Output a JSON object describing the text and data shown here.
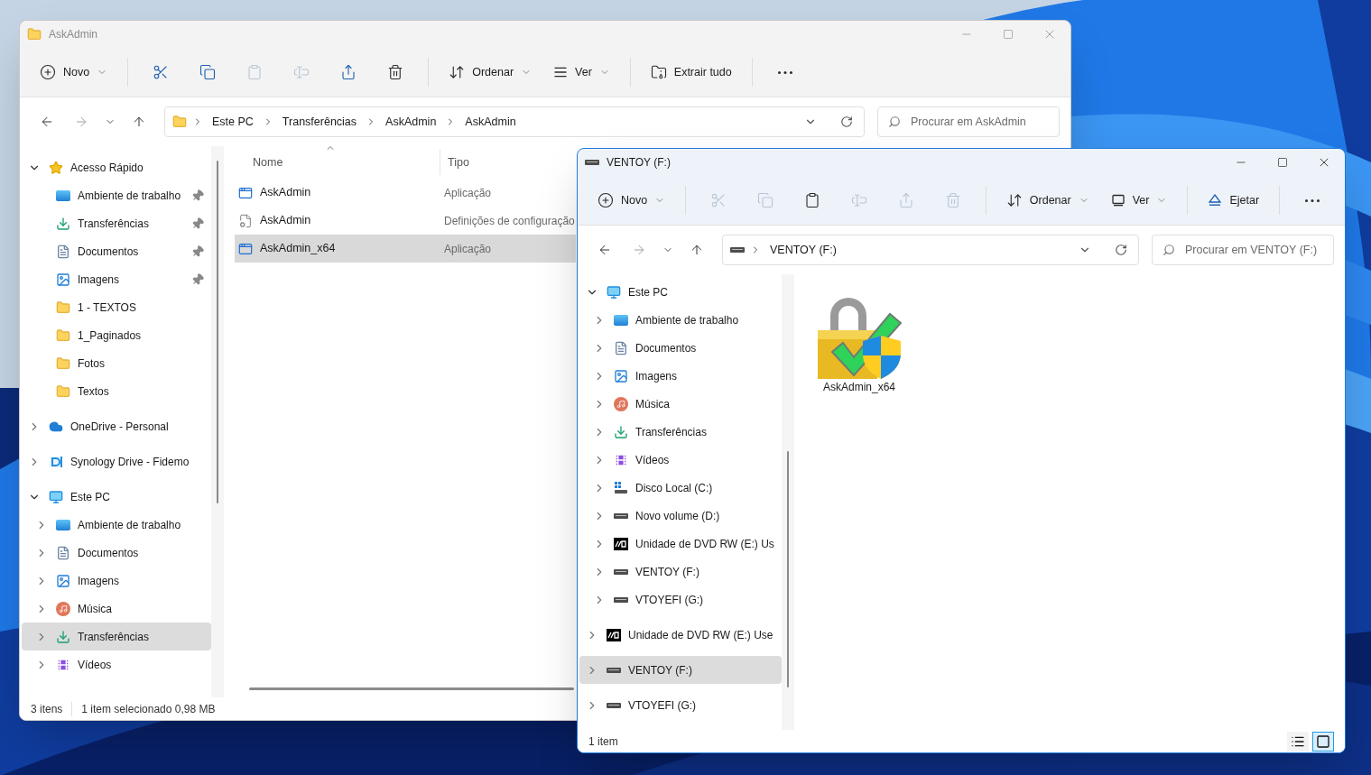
{
  "windows": [
    {
      "kind": "details",
      "title": "AskAdmin",
      "active": false,
      "toolbar": [
        {
          "kind": "new",
          "label": "Novo",
          "disabled": false
        },
        {
          "kind": "cut",
          "disabled": false
        },
        {
          "kind": "copy",
          "disabled": false
        },
        {
          "kind": "paste",
          "disabled": true
        },
        {
          "kind": "rename",
          "disabled": true
        },
        {
          "kind": "share",
          "disabled": false
        },
        {
          "kind": "delete",
          "disabled": false
        },
        {
          "kind": "sort",
          "label": "Ordenar",
          "disabled": false
        },
        {
          "kind": "view",
          "label": "Ver",
          "disabled": false
        },
        {
          "kind": "extract",
          "label": "Extrair tudo",
          "disabled": false
        },
        {
          "kind": "more",
          "disabled": false
        }
      ],
      "navigation": {
        "back": {
          "disabled": false
        },
        "forward": {
          "disabled": true
        },
        "up": {
          "disabled": false
        }
      },
      "breadcrumb": [
        "Este PC",
        "Transferências",
        "AskAdmin",
        "AskAdmin"
      ],
      "search_placeholder": "Procurar em AskAdmin",
      "sidebar": [
        {
          "label": "Acesso Rápido",
          "kind": "star",
          "expanded": true,
          "selected": false,
          "children": [
            {
              "label": "Ambiente de trabalho",
              "kind": "desktop",
              "pinned": true,
              "selected": false
            },
            {
              "label": "Transferências",
              "kind": "downloads",
              "pinned": true,
              "selected": false
            },
            {
              "label": "Documentos",
              "kind": "documents",
              "pinned": true,
              "selected": false
            },
            {
              "label": "Imagens",
              "kind": "pictures",
              "pinned": true,
              "selected": false
            },
            {
              "label": "1 - TEXTOS",
              "kind": "folder",
              "pinned": false,
              "selected": false
            },
            {
              "label": "1_Paginados",
              "kind": "folder",
              "pinned": false,
              "selected": false
            },
            {
              "label": "Fotos",
              "kind": "folder",
              "pinned": false,
              "selected": false
            },
            {
              "label": "Textos",
              "kind": "folder",
              "pinned": false,
              "selected": false
            }
          ]
        },
        {
          "label": "OneDrive - Personal",
          "kind": "cloud",
          "expanded": false,
          "selected": false
        },
        {
          "label": "Synology Drive - Fidemo",
          "kind": "synology",
          "expanded": false,
          "selected": false
        },
        {
          "label": "Este PC",
          "kind": "pc",
          "expanded": true,
          "selected": false,
          "children": [
            {
              "label": "Ambiente de trabalho",
              "kind": "desktop",
              "expanded": false,
              "selected": false
            },
            {
              "label": "Documentos",
              "kind": "documents",
              "expanded": false,
              "selected": false
            },
            {
              "label": "Imagens",
              "kind": "pictures",
              "expanded": false,
              "selected": false
            },
            {
              "label": "Música",
              "kind": "music",
              "expanded": false,
              "selected": false
            },
            {
              "label": "Transferências",
              "kind": "downloads",
              "expanded": false,
              "selected": true
            },
            {
              "label": "Vídeos",
              "kind": "videos",
              "expanded": false,
              "selected": false
            }
          ]
        }
      ],
      "columns": [
        {
          "label": "Nome",
          "sorted": true
        },
        {
          "label": "Tipo",
          "sorted": false
        }
      ],
      "files": [
        {
          "name": "AskAdmin",
          "type": "Aplicação",
          "kind": "app",
          "selected": false
        },
        {
          "name": "AskAdmin",
          "type": "Definições de configuração",
          "kind": "config",
          "selected": false
        },
        {
          "name": "AskAdmin_x64",
          "type": "Aplicação",
          "kind": "app",
          "selected": true
        }
      ],
      "status": [
        "3 itens",
        "1 item selecionado 0,98 MB"
      ]
    },
    {
      "kind": "icons",
      "title": "VENTOY (F:)",
      "active": true,
      "toolbar": [
        {
          "kind": "new",
          "label": "Novo",
          "disabled": false
        },
        {
          "kind": "cut",
          "disabled": true
        },
        {
          "kind": "copy",
          "disabled": true
        },
        {
          "kind": "paste",
          "disabled": false
        },
        {
          "kind": "rename",
          "disabled": true
        },
        {
          "kind": "share",
          "disabled": true
        },
        {
          "kind": "delete",
          "disabled": true
        },
        {
          "kind": "sort",
          "label": "Ordenar",
          "disabled": false
        },
        {
          "kind": "view",
          "label": "Ver",
          "disabled": false
        },
        {
          "kind": "eject",
          "label": "Ejetar",
          "disabled": false
        },
        {
          "kind": "more",
          "disabled": false
        }
      ],
      "navigation": {
        "back": {
          "disabled": false
        },
        "forward": {
          "disabled": true
        },
        "up": {
          "disabled": false
        }
      },
      "breadcrumb": [
        "VENTOY (F:)"
      ],
      "search_placeholder": "Procurar em VENTOY (F:)",
      "sidebar": [
        {
          "label": "Este PC",
          "kind": "pc",
          "expanded": true,
          "selected": false,
          "children": [
            {
              "label": "Ambiente de trabalho",
              "kind": "desktop",
              "expanded": false,
              "selected": false
            },
            {
              "label": "Documentos",
              "kind": "documents",
              "expanded": false,
              "selected": false
            },
            {
              "label": "Imagens",
              "kind": "pictures",
              "expanded": false,
              "selected": false
            },
            {
              "label": "Música",
              "kind": "music",
              "expanded": false,
              "selected": false
            },
            {
              "label": "Transferências",
              "kind": "downloads",
              "expanded": false,
              "selected": false
            },
            {
              "label": "Vídeos",
              "kind": "videos",
              "expanded": false,
              "selected": false
            },
            {
              "label": "Disco Local (C:)",
              "kind": "system_disk",
              "expanded": false,
              "selected": false
            },
            {
              "label": "Novo volume (D:)",
              "kind": "drive",
              "expanded": false,
              "selected": false
            },
            {
              "label": "Unidade de DVD RW (E:) Us",
              "kind": "dvd",
              "expanded": false,
              "selected": false
            },
            {
              "label": "VENTOY (F:)",
              "kind": "drive",
              "expanded": false,
              "selected": false
            },
            {
              "label": "VTOYEFI (G:)",
              "kind": "drive",
              "expanded": false,
              "selected": false
            }
          ]
        },
        {
          "label": "Unidade de DVD RW (E:) Use",
          "kind": "dvd",
          "expanded": false,
          "selected": false
        },
        {
          "label": "VENTOY (F:)",
          "kind": "drive",
          "expanded": false,
          "selected": true
        },
        {
          "label": "VTOYEFI (G:)",
          "kind": "drive",
          "expanded": false,
          "selected": false
        }
      ],
      "files": [
        {
          "name": "AskAdmin_x64",
          "kind": "lock_app",
          "selected": false
        }
      ],
      "status": [
        "1 item"
      ],
      "view_buttons": [
        {
          "kind": "details",
          "selected": false
        },
        {
          "kind": "large_icons",
          "selected": true
        }
      ]
    }
  ]
}
